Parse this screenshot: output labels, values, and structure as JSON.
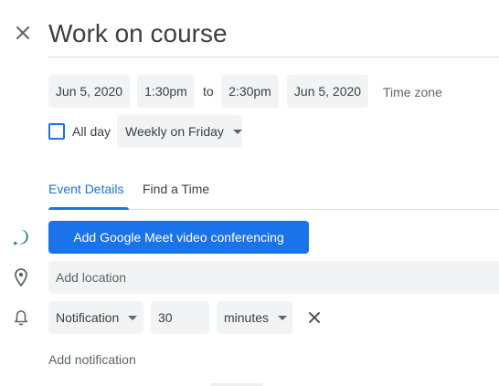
{
  "event": {
    "title": "Work on course"
  },
  "datetime": {
    "start_date": "Jun 5, 2020",
    "start_time": "1:30pm",
    "to_label": "to",
    "end_time": "2:30pm",
    "end_date": "Jun 5, 2020",
    "timezone_label": "Time zone"
  },
  "options": {
    "all_day_label": "All day",
    "all_day_checked": false,
    "recurrence": "Weekly on Friday"
  },
  "tabs": [
    {
      "label": "Event Details",
      "active": true
    },
    {
      "label": "Find a Time",
      "active": false
    }
  ],
  "details": {
    "meet_button_label": "Add Google Meet video conferencing",
    "location_placeholder": "Add location"
  },
  "notification": {
    "type": "Notification",
    "amount": "30",
    "unit": "minutes",
    "add_label": "Add notification"
  },
  "colors": {
    "accent": "#1a73e8",
    "meet_green": "#00832d",
    "field_bg": "#f1f3f4",
    "text": "#3c4043"
  }
}
